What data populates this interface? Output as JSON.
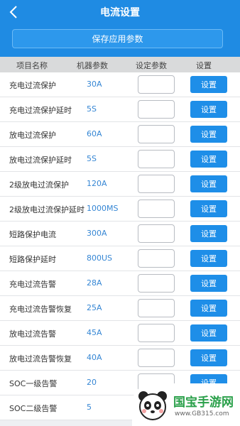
{
  "header": {
    "title": "电流设置",
    "back_icon": "chevron-left-icon",
    "save_button": "保存应用参数"
  },
  "columns": [
    "项目名称",
    "机器参数",
    "设定参数",
    "设置"
  ],
  "rows": [
    {
      "name": "充电过流保护",
      "value": "30A",
      "set_value": "",
      "button": "设置"
    },
    {
      "name": "充电过流保护延时",
      "value": "5S",
      "set_value": "",
      "button": "设置"
    },
    {
      "name": "放电过流保护",
      "value": "60A",
      "set_value": "",
      "button": "设置"
    },
    {
      "name": "放电过流保护延时",
      "value": "5S",
      "set_value": "",
      "button": "设置"
    },
    {
      "name": "2级放电过流保护",
      "value": "120A",
      "set_value": "",
      "button": "设置"
    },
    {
      "name": "2级放电过流保护延时",
      "value": "1000MS",
      "set_value": "",
      "button": "设置"
    },
    {
      "name": "短路保护电流",
      "value": "300A",
      "set_value": "",
      "button": "设置"
    },
    {
      "name": "短路保护延时",
      "value": "800US",
      "set_value": "",
      "button": "设置"
    },
    {
      "name": "充电过流告警",
      "value": "28A",
      "set_value": "",
      "button": "设置"
    },
    {
      "name": "充电过流告警恢复",
      "value": "25A",
      "set_value": "",
      "button": "设置"
    },
    {
      "name": "放电过流告警",
      "value": "45A",
      "set_value": "",
      "button": "设置"
    },
    {
      "name": "放电过流告警恢复",
      "value": "40A",
      "set_value": "",
      "button": "设置"
    },
    {
      "name": "SOC一级告警",
      "value": "20",
      "set_value": "",
      "button": "设置"
    },
    {
      "name": "SOC二级告警",
      "value": "5",
      "set_value": "",
      "button": "设置"
    }
  ],
  "watermark": {
    "text": "国宝手游网",
    "url": "www.GB315.com"
  },
  "colors": {
    "header_blue": "#1f8be3",
    "button_blue": "#1e8ee8",
    "value_blue": "#3586d4"
  }
}
